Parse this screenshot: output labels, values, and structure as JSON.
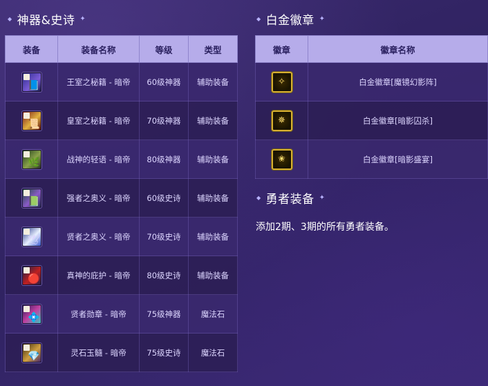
{
  "artifact_section": {
    "title": "神器&史诗",
    "headers": [
      "装备",
      "装备名称",
      "等级",
      "类型"
    ],
    "rows": [
      {
        "name": "王室之秘籍 - 暗帝",
        "level": "60级神器",
        "type": "辅助装备",
        "icon": "book-icon"
      },
      {
        "name": "皇室之秘籍 - 暗帝",
        "level": "70级神器",
        "type": "辅助装备",
        "icon": "scroll-icon"
      },
      {
        "name": "战神的轻语 - 暗帝",
        "level": "80级神器",
        "type": "辅助装备",
        "icon": "horn-icon"
      },
      {
        "name": "强者之奥义 - 暗帝",
        "level": "60级史诗",
        "type": "辅助装备",
        "icon": "tome-icon"
      },
      {
        "name": "贤者之奥义 - 暗帝",
        "level": "70级史诗",
        "type": "辅助装备",
        "icon": "wing-book-icon"
      },
      {
        "name": "真神的庇护 - 暗帝",
        "level": "80级史诗",
        "type": "辅助装备",
        "icon": "orb-icon"
      },
      {
        "name": "贤者勋章 - 暗帝",
        "level": "75级神器",
        "type": "魔法石",
        "icon": "medal-icon"
      },
      {
        "name": "灵石玉髓 - 暗帝",
        "level": "75级史诗",
        "type": "魔法石",
        "icon": "crystal-icon"
      }
    ]
  },
  "platinum_section": {
    "title": "白金徽章",
    "headers": [
      "徽章",
      "徽章名称"
    ],
    "rows": [
      {
        "name": "白金徽章[魔镜幻影阵]",
        "icon": "platinum-badge-icon"
      },
      {
        "name": "白金徽章[暗影囚杀]",
        "icon": "platinum-badge-icon"
      },
      {
        "name": "白金徽章[暗影盛宴]",
        "icon": "platinum-badge-icon"
      }
    ]
  },
  "hero_section": {
    "title": "勇者装备",
    "text": "添加2期、3期的所有勇者装备。"
  },
  "colors": {
    "header_bg": "#b6acea",
    "header_text": "#2b2160",
    "row_odd": "#3a286e",
    "row_even": "#2c1e56",
    "badge_gold": "#d8b030"
  }
}
